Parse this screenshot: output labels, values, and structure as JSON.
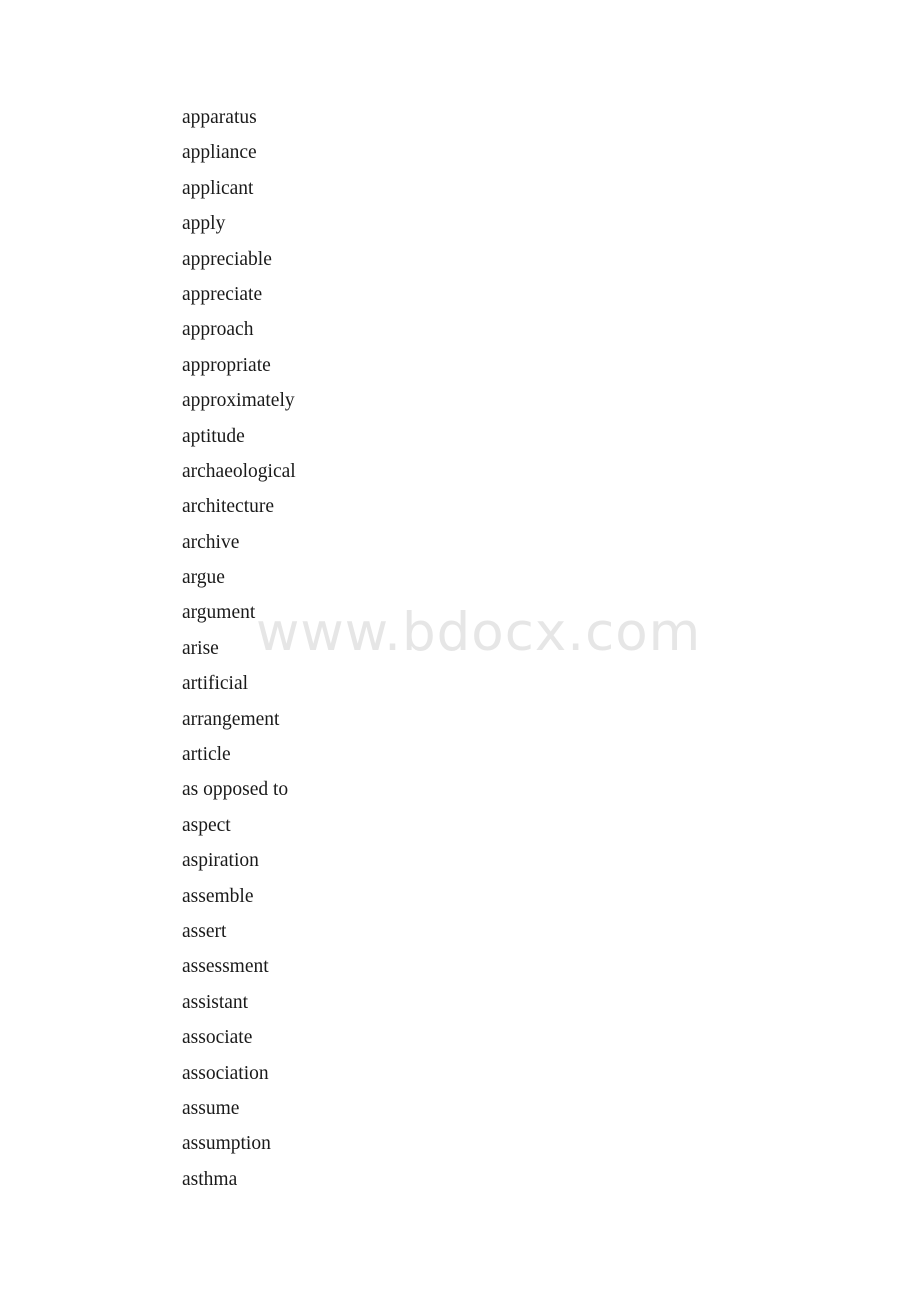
{
  "document": {
    "background_color": "#ffffff",
    "text_color": "#1a1a1a",
    "watermark": {
      "text": "www.bdocx.com",
      "color": "#e6e6e6"
    },
    "word_list": [
      "apparatus",
      "appliance",
      "applicant",
      "apply",
      "appreciable",
      "appreciate",
      "approach",
      "appropriate",
      "approximately",
      "aptitude",
      "archaeological",
      "architecture",
      "archive",
      "argue",
      "argument",
      "arise",
      "artificial",
      "arrangement",
      "article",
      "as opposed to",
      "aspect",
      "aspiration",
      "assemble",
      "assert",
      "assessment",
      "assistant",
      "associate",
      "association",
      "assume",
      "assumption",
      "asthma"
    ]
  }
}
